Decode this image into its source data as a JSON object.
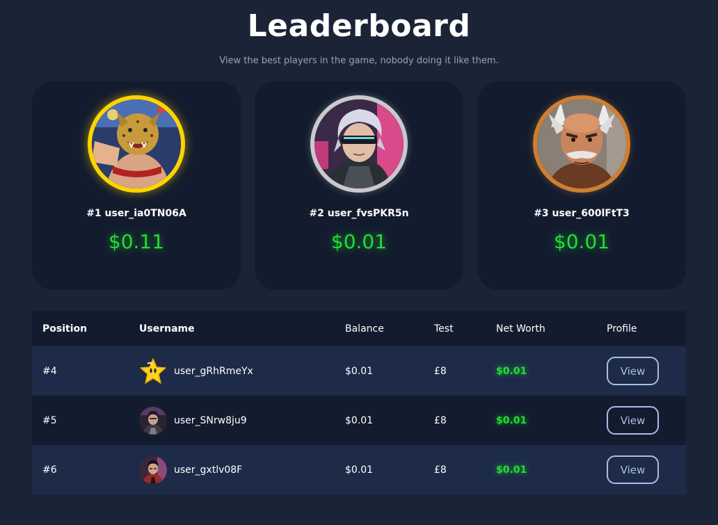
{
  "header": {
    "title": "Leaderboard",
    "subtitle": "View the best players in the game, nobody doing it like them."
  },
  "podium": [
    {
      "rank_label": "#1 user_ia0TN06A",
      "amount": "$0.11",
      "avatar_icon": "jaguar-mask-fighter-avatar",
      "ring_color": "#ffd400"
    },
    {
      "rank_label": "#2 user_fvsPKR5n",
      "amount": "$0.01",
      "avatar_icon": "silver-haired-visor-fighter-avatar",
      "ring_color": "#c9c9cf"
    },
    {
      "rank_label": "#3 user_600lFtT3",
      "amount": "$0.01",
      "avatar_icon": "bald-old-fighter-avatar",
      "ring_color": "#cd7f32"
    }
  ],
  "table": {
    "columns": [
      "Position",
      "Username",
      "Balance",
      "Test",
      "Net Worth",
      "Profile"
    ],
    "rows": [
      {
        "position": "#4",
        "username": "user_gRhRmeYx",
        "balance": "$0.01",
        "test": "£8",
        "net_worth": "$0.01",
        "profile_button": "View",
        "avatar_icon": "star-icon"
      },
      {
        "position": "#5",
        "username": "user_SNrw8ju9",
        "balance": "$0.01",
        "test": "£8",
        "net_worth": "$0.01",
        "profile_button": "View",
        "avatar_icon": "dark-fighter-avatar"
      },
      {
        "position": "#6",
        "username": "user_gxtlv08F",
        "balance": "$0.01",
        "test": "£8",
        "net_worth": "$0.01",
        "profile_button": "View",
        "avatar_icon": "red-jacket-fighter-avatar"
      }
    ]
  },
  "colors": {
    "background": "#1b2436",
    "card": "#131c2e",
    "row_alt": "#1e2b48",
    "money_green": "#22dd33",
    "button_outline": "#a8bfe8"
  }
}
